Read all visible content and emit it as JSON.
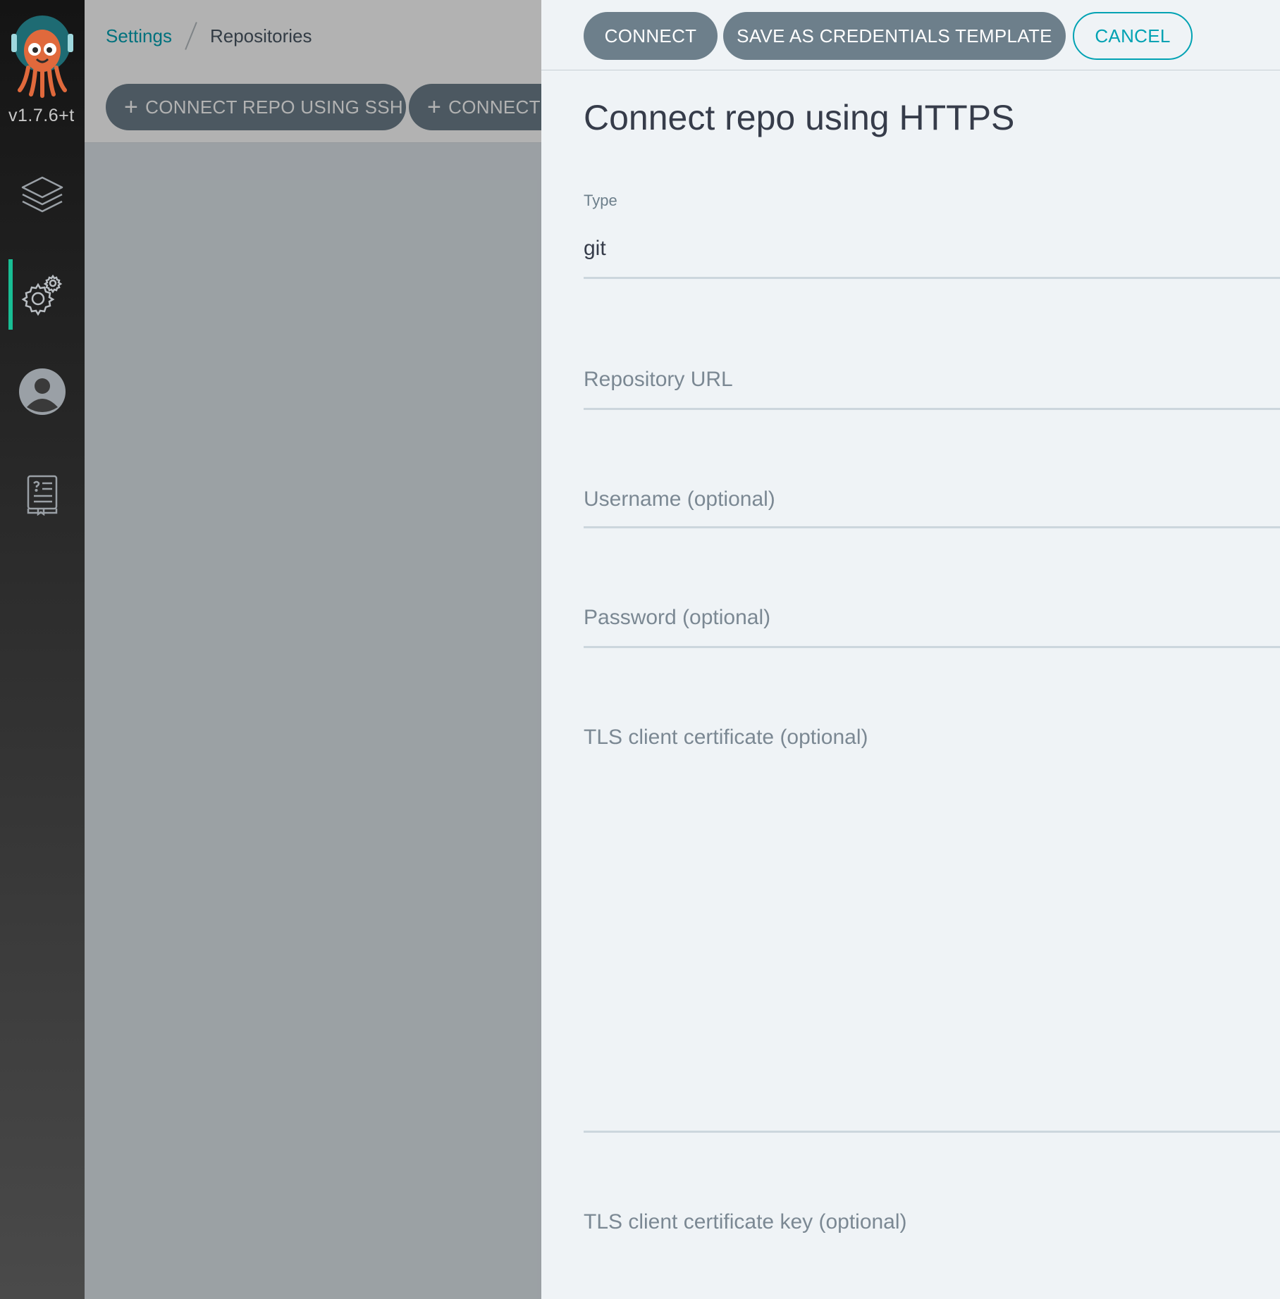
{
  "sidebar": {
    "version": "v1.7.6+t",
    "items": [
      {
        "name": "applications",
        "icon": "layers-icon"
      },
      {
        "name": "settings",
        "icon": "gear-icon",
        "active": true
      },
      {
        "name": "user-info",
        "icon": "user-icon"
      },
      {
        "name": "documentation",
        "icon": "docs-icon"
      }
    ]
  },
  "breadcrumb": {
    "parent": "Settings",
    "current": "Repositories"
  },
  "actions": {
    "connect_ssh": "CONNECT REPO USING SSH",
    "connect_https_truncated": "CONNECT I"
  },
  "panel": {
    "buttons": {
      "connect": "CONNECT",
      "save_template": "SAVE AS CREDENTIALS TEMPLATE",
      "cancel": "CANCEL"
    },
    "title": "Connect repo using HTTPS",
    "fields": {
      "type": {
        "label": "Type",
        "value": "git"
      },
      "repo_url": {
        "placeholder": "Repository URL"
      },
      "username": {
        "placeholder": "Username (optional)"
      },
      "password": {
        "placeholder": "Password (optional)"
      },
      "tls_cert": {
        "label": "TLS client certificate (optional)"
      },
      "tls_key": {
        "label": "TLS client certificate key (optional)"
      }
    }
  },
  "colors": {
    "accent": "#00a2b3",
    "active_indicator": "#18be94",
    "button": "#6d7f8b",
    "panel_bg": "#eff3f6"
  }
}
